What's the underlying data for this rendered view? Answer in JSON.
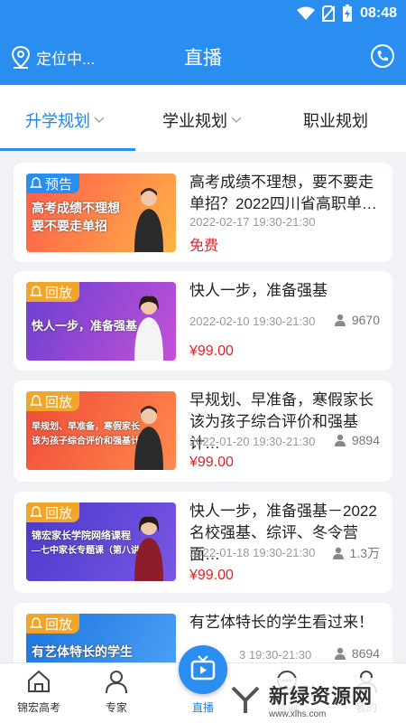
{
  "statusbar": {
    "time": "08:48"
  },
  "header": {
    "location": "定位中...",
    "title": "直播"
  },
  "tabs": [
    {
      "label": "升学规划",
      "active": true,
      "has_dropdown": true
    },
    {
      "label": "学业规划",
      "active": false,
      "has_dropdown": true
    },
    {
      "label": "职业规划",
      "active": false,
      "has_dropdown": false
    }
  ],
  "cards": [
    {
      "badge": "预告",
      "badge_type": "notice",
      "banner_line1": "高考成绩不理想",
      "banner_line2": "要不要走单招",
      "banner_colors": [
        "#ff6b4a",
        "#ffb347"
      ],
      "title": "高考成绩不理想，要不要走单招？2022四川省高职单…",
      "time": "2022-02-17 19:30-21:30",
      "price": "免费",
      "viewers": ""
    },
    {
      "badge": "回放",
      "badge_type": "replay",
      "banner_line1": "快人一步，准备强基",
      "banner_line2": "",
      "banner_colors": [
        "#6a3fd1",
        "#c451d8"
      ],
      "title": "快人一步，准备强基",
      "time": "2022-02-10 19:30-21:30",
      "price": "¥99.00",
      "viewers": "9670"
    },
    {
      "badge": "回放",
      "badge_type": "replay",
      "banner_line1": "早规划、早准备，寒假家长",
      "banner_line2": "该为孩子综合评价和强基计划",
      "banner_colors": [
        "#f04a3a",
        "#ff8a4c"
      ],
      "title": "早规划、早准备，寒假家长该为孩子综合评价和强基计…",
      "time": "2022-01-20 19:30-21:30",
      "price": "¥99.00",
      "viewers": "9894"
    },
    {
      "badge": "回放",
      "badge_type": "replay",
      "banner_line1": "锦宏家长学院网络课程",
      "banner_line2": "—七中家长专题课（第八讲）",
      "banner_colors": [
        "#4b3ac9",
        "#7a56e6"
      ],
      "title": "快人一步，准备强基－2022名校强基、综评、冬令营面…",
      "time": "2022-01-18 19:30-21:30",
      "price": "¥99.00",
      "viewers": "1.3万"
    },
    {
      "badge": "回放",
      "badge_type": "replay",
      "banner_line1": "有艺体特长的学生",
      "banner_line2": "",
      "banner_colors": [
        "#1b75e0",
        "#4da0f5"
      ],
      "title": "有艺体特长的学生看过来！",
      "time": "3 19:30-21:30",
      "price": "",
      "viewers": "8694"
    }
  ],
  "nav": {
    "home": "锦宏高考",
    "expert": "专家",
    "live": "直播",
    "consult": "咨询",
    "mine": "我的"
  },
  "watermark": {
    "main": "新绿资源网",
    "sub": "www.xlhs.com"
  },
  "colors": {
    "primary": "#2a8ef0",
    "price": "#e02424",
    "replay_badge": "#f2a629"
  }
}
